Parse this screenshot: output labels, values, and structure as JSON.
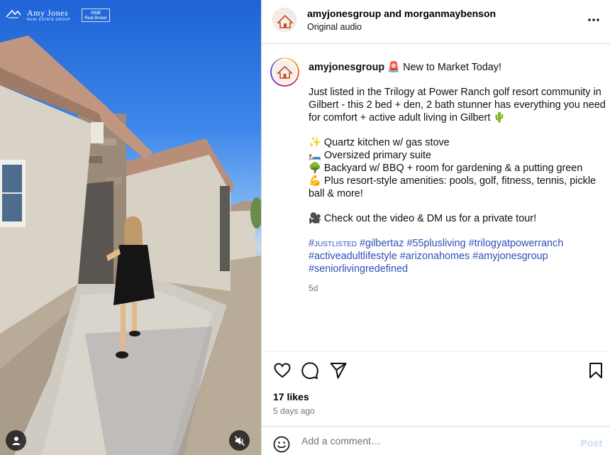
{
  "media": {
    "brand": {
      "name": "Amy Jones",
      "sub": "REAL ESTATE GROUP",
      "badge_main": "real",
      "badge_sub": "Real Broker"
    },
    "icons": {
      "user": "user-icon",
      "mute": "speaker-muted-icon"
    }
  },
  "header": {
    "title": "amyjonesgroup and morganmaybenson",
    "subtitle": "Original audio",
    "more_icon": "more-horizontal-icon"
  },
  "caption": {
    "username": "amyjonesgroup",
    "headline": "🚨 New to Market Today!",
    "paragraph": "Just listed in the Trilogy at Power Ranch golf resort community in Gilbert - this 2 bed + den, 2 bath stunner has everything you need for comfort + active adult living in Gilbert 🌵",
    "bullets": [
      "✨ Quartz kitchen w/ gas stove",
      "🛏️ Oversized primary suite",
      "🌳 Backyard w/ BBQ + room for gardening & a putting green",
      "💪 Plus resort-style amenities: pools, golf, fitness, tennis, pickle ball & more!"
    ],
    "cta": "🎥 Check out the video & DM us for a private tour!",
    "hashtags": [
      "#justlisted",
      "#gilbertaz",
      "#55plusliving",
      "#trilogyatpowerranch",
      "#activeadultlifestyle",
      "#arizonahomes",
      "#amyjonesgroup",
      "#seniorlivingredefined"
    ],
    "time": "5d"
  },
  "actions": {
    "like_icon": "heart-icon",
    "comment_icon": "comment-icon",
    "share_icon": "send-icon",
    "save_icon": "bookmark-icon"
  },
  "stats": {
    "likes": "17 likes",
    "posted": "5 days ago"
  },
  "comment": {
    "placeholder": "Add a comment…",
    "post_label": "Post",
    "emoji_icon": "smiley-icon"
  },
  "colors": {
    "hashtag": "#2f4fb8",
    "muted": "#737373",
    "post_disabled": "#c7dbf7"
  }
}
